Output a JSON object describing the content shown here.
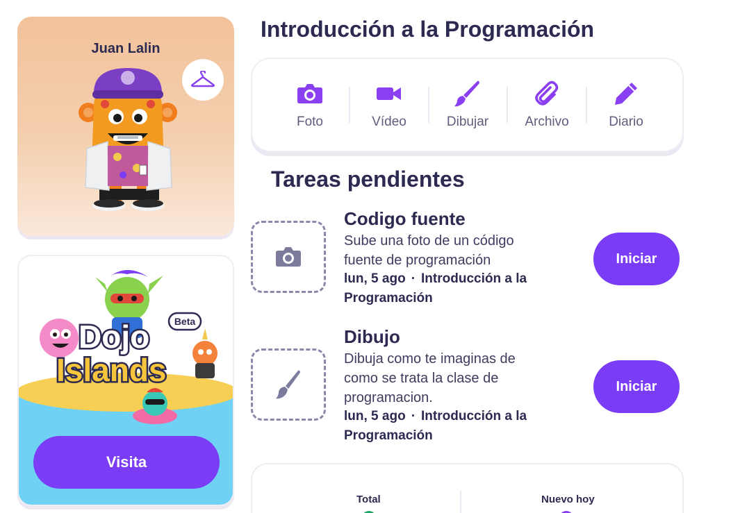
{
  "profile": {
    "name": "Juan Lalin"
  },
  "islands": {
    "title_line1": "Dojo",
    "title_line2": "Islands",
    "badge": "Beta",
    "visit_label": "Visita"
  },
  "class": {
    "title": "Introducción a la Programación"
  },
  "upload_options": [
    {
      "label": "Foto",
      "icon": "camera-icon"
    },
    {
      "label": "Vídeo",
      "icon": "video-icon"
    },
    {
      "label": "Dibujar",
      "icon": "brush-icon"
    },
    {
      "label": "Archivo",
      "icon": "paperclip-icon"
    },
    {
      "label": "Diario",
      "icon": "pencil-icon"
    }
  ],
  "tasks": {
    "title": "Tareas pendientes",
    "items": [
      {
        "name": "Codigo fuente",
        "description": "Sube una foto de un código fuente de programación",
        "date": "lun, 5 ago",
        "class_line1": "Introducción a la",
        "class_line2": "Programación",
        "button": "Iniciar",
        "icon": "camera-icon"
      },
      {
        "name": "Dibujo",
        "description": "Dibuja como te imaginas de como se trata la clase de programacion.",
        "date": "lun, 5 ago",
        "class_line1": "Introducción a la",
        "class_line2": "Programación",
        "button": "Iniciar",
        "icon": "brush-icon"
      }
    ]
  },
  "stats": {
    "total_label": "Total",
    "new_today_label": "Nuevo hoy"
  },
  "colors": {
    "accent": "#7a3cf5",
    "icon_purple": "#8a3ff0",
    "text_dark": "#2c2a50"
  }
}
